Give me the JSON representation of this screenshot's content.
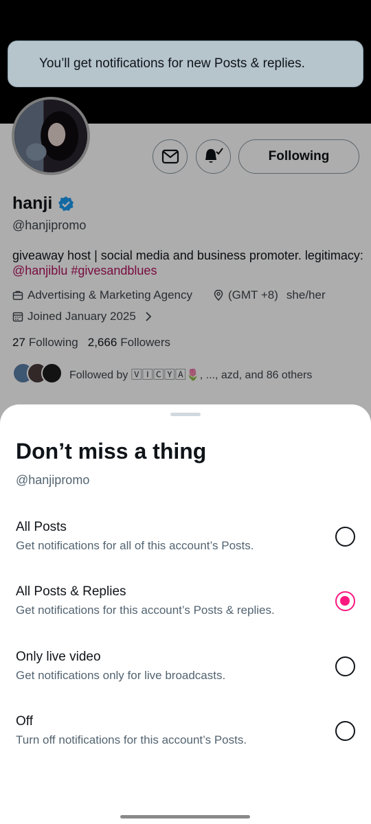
{
  "toast": {
    "text": "You’ll get notifications for new Posts & replies."
  },
  "profile": {
    "name": "hanji",
    "handle": "@hanjipromo",
    "bio_text": "giveaway host | social media and business promoter. legitimacy:",
    "bio_link_1": "@hanjiblu",
    "bio_link_2": "#givesandblues",
    "category": "Advertising & Marketing Agency",
    "location": "(GMT +8)",
    "pronouns": "she/her",
    "joined": "Joined January 2025",
    "following_count": "27",
    "following_label": "Following",
    "followers_count": "2,666",
    "followers_label": "Followers",
    "followed_by": "Followed by 🅅🄸🄲🅈🄰🌷, ..., azd, and 86 others",
    "following_button": "Following"
  },
  "sheet": {
    "title": "Don’t miss a thing",
    "handle": "@hanjipromo",
    "options": [
      {
        "label": "All Posts",
        "desc": "Get notifications for all of this account’s Posts.",
        "selected": false
      },
      {
        "label": "All Posts & Replies",
        "desc": "Get notifications for this account’s Posts & replies.",
        "selected": true
      },
      {
        "label": "Only live video",
        "desc": "Get notifications only for live broadcasts.",
        "selected": false
      },
      {
        "label": "Off",
        "desc": "Turn off notifications for this account’s Posts.",
        "selected": false
      }
    ]
  },
  "colors": {
    "accent": "#f91880",
    "link": "#b0135d",
    "verified": "#1d9bf0"
  },
  "icons": [
    "mail-icon",
    "bell-check-icon",
    "verified-badge-icon",
    "briefcase-icon",
    "location-pin-icon",
    "calendar-icon",
    "chevron-right-icon"
  ]
}
